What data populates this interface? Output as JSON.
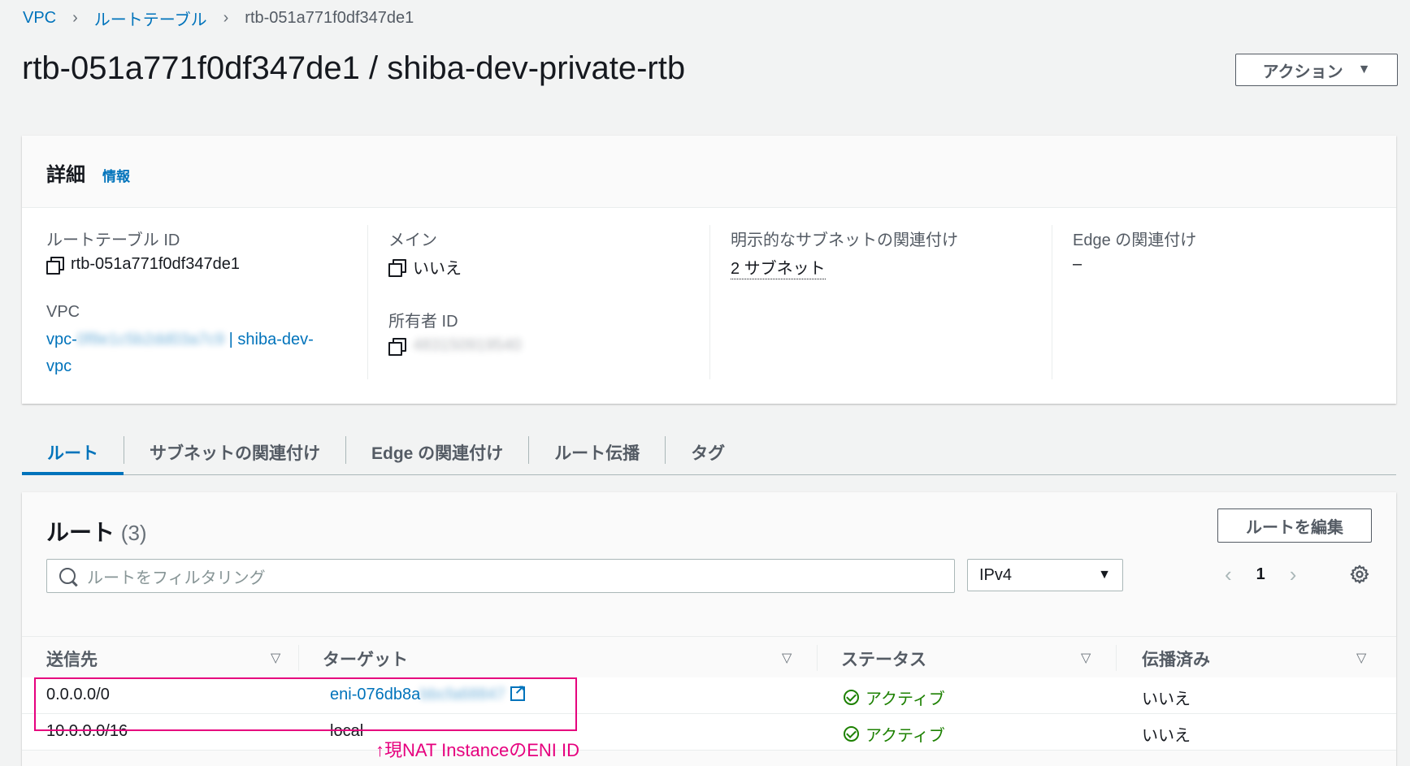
{
  "breadcrumb": {
    "items": [
      "VPC",
      "ルートテーブル",
      "rtb-051a771f0df347de1"
    ]
  },
  "page_title": "rtb-051a771f0df347de1 / shiba-dev-private-rtb",
  "actions_button": "アクション",
  "details": {
    "title": "詳細",
    "info_link": "情報",
    "route_table_id_label": "ルートテーブル ID",
    "route_table_id": "rtb-051a771f0df347de1",
    "vpc_label": "VPC",
    "vpc_prefix": "vpc-",
    "vpc_id_redacted": "0f8e1c5b2dd03a7c9",
    "vpc_name_a": "| shiba-dev-",
    "vpc_name_b": "vpc",
    "main_label": "メイン",
    "main_value": "いいえ",
    "owner_label": "所有者 ID",
    "owner_value_redacted": "483150919540",
    "subnet_assoc_label": "明示的なサブネットの関連付け",
    "subnet_assoc_value": "2 サブネット",
    "edge_assoc_label": "Edge の関連付け",
    "edge_assoc_value": "–"
  },
  "tabs": [
    "ルート",
    "サブネットの関連付け",
    "Edge の関連付け",
    "ルート伝播",
    "タグ"
  ],
  "routes": {
    "title": "ルート",
    "count": "(3)",
    "edit_button": "ルートを編集",
    "search_placeholder": "ルートをフィルタリング",
    "ip_filter": "IPv4",
    "page": "1",
    "columns": [
      "送信先",
      "ターゲット",
      "ステータス",
      "伝播済み"
    ],
    "rows": [
      {
        "destination": "0.0.0.0/0",
        "target": "eni-076db8a",
        "target_redacted": "bbcfa68847",
        "status": "アクティブ",
        "propagated": "いいえ"
      },
      {
        "destination": "10.0.0.0/16",
        "target": "local",
        "status": "アクティブ",
        "propagated": "いいえ"
      }
    ]
  },
  "annotation": "↑現NAT InstanceのENI ID",
  "colors": {
    "link": "#0073bb",
    "active_status": "#1d8102",
    "annotation": "#e6007e"
  }
}
